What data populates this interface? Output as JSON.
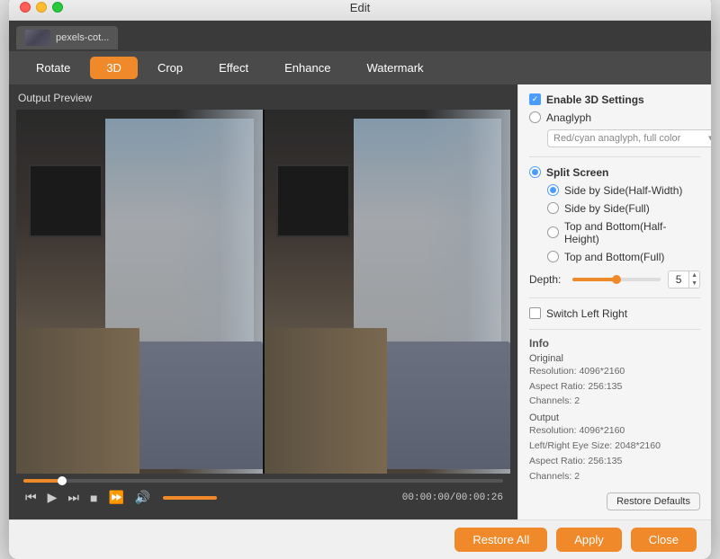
{
  "window": {
    "title": "Edit"
  },
  "file_tab": {
    "label": "pexels-cot..."
  },
  "toolbar": {
    "tabs": [
      {
        "id": "rotate",
        "label": "Rotate",
        "active": false
      },
      {
        "id": "3d",
        "label": "3D",
        "active": true
      },
      {
        "id": "crop",
        "label": "Crop",
        "active": false
      },
      {
        "id": "effect",
        "label": "Effect",
        "active": false
      },
      {
        "id": "enhance",
        "label": "Enhance",
        "active": false
      },
      {
        "id": "watermark",
        "label": "Watermark",
        "active": false
      }
    ]
  },
  "preview": {
    "label": "Output Preview",
    "time_current": "00:00:00",
    "time_total": "00:00:26",
    "time_display": "00:00:00/00:00:26"
  },
  "settings": {
    "enable_3d_label": "Enable 3D Settings",
    "anaglyph_label": "Anaglyph",
    "anaglyph_option": "Red/cyan anaglyph, full color",
    "split_screen_label": "Split Screen",
    "side_by_side_half": "Side by Side(Half-Width)",
    "side_by_side_full": "Side by Side(Full)",
    "top_bottom_half": "Top and Bottom(Half-Height)",
    "top_bottom_full": "Top and Bottom(Full)",
    "depth_label": "Depth:",
    "depth_value": "5",
    "switch_left_right_label": "Switch Left Right",
    "info_title": "Info",
    "original_label": "Original",
    "original_resolution": "Resolution: 4096*2160",
    "original_aspect": "Aspect Ratio: 256:135",
    "original_channels": "Channels: 2",
    "output_label": "Output",
    "output_resolution": "Resolution: 4096*2160",
    "output_eye_size": "Left/Right Eye Size: 2048*2160",
    "output_aspect": "Aspect Ratio: 256:135",
    "output_channels": "Channels: 2",
    "restore_defaults_label": "Restore Defaults"
  },
  "bottom_bar": {
    "restore_all_label": "Restore All",
    "apply_label": "Apply",
    "close_label": "Close"
  },
  "colors": {
    "accent": "#f0892a",
    "active_radio": "#4a9dff"
  }
}
